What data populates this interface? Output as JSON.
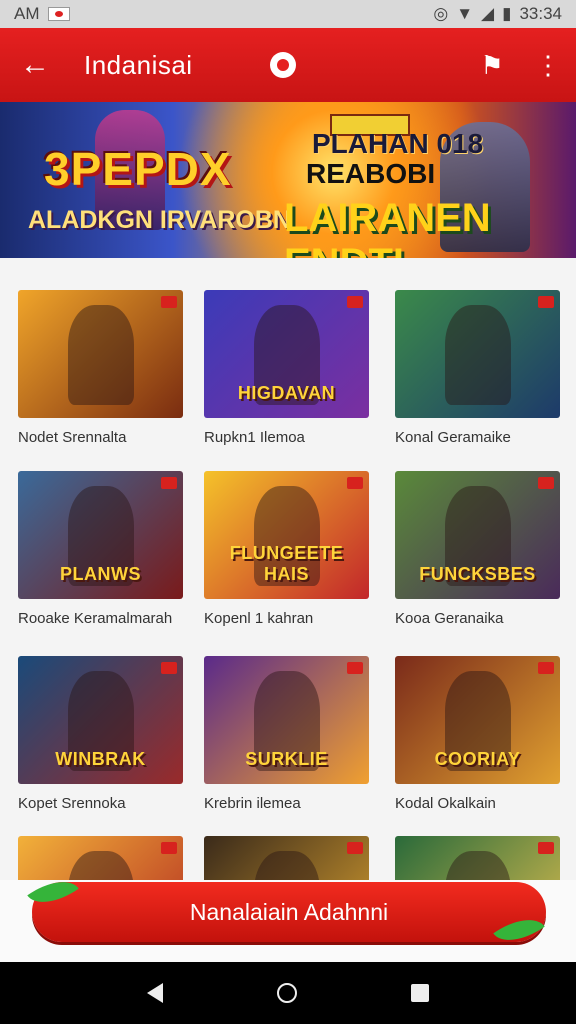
{
  "status_bar": {
    "left_text": "AM",
    "time": "33:34"
  },
  "app_bar": {
    "title": "Indanisai"
  },
  "icons": {
    "back": "arrow-left-icon",
    "chat": "chat-flag-icon",
    "more": "more-vertical-icon"
  },
  "banner": {
    "headline": "3PEPDX",
    "subtitle": "ALADKGN IRVAROBN",
    "tag_line_1": "PLAHAN 018",
    "tag_line_2": "REABOBI",
    "main_line": "LAIRANEN ENDTI"
  },
  "games": [
    {
      "title": "Nodet Srennalta",
      "caption": "",
      "colors": [
        "#f0a52a",
        "#7a2c10"
      ]
    },
    {
      "title": "Rupkn1 Ilemoa",
      "caption": "HIGDAVAN",
      "colors": [
        "#3b3bb8",
        "#7b2fa0"
      ]
    },
    {
      "title": "Konal Geramaike",
      "caption": "",
      "colors": [
        "#3b8a4a",
        "#1d3a6a"
      ]
    },
    {
      "title": "Rooake Keramalmarah",
      "caption": "PLANWS",
      "colors": [
        "#3a6a9a",
        "#7a1a1a"
      ]
    },
    {
      "title": "Kopenl 1 kahran",
      "caption": "FLUNGEETE HAIS",
      "colors": [
        "#f5c22a",
        "#c2262a"
      ]
    },
    {
      "title": "Kooa Geranaika",
      "caption": "FUNCKSBES",
      "colors": [
        "#5a8a3a",
        "#4a2a5a"
      ]
    },
    {
      "title": "Kopet Srennoka",
      "caption": "WINBRAK",
      "colors": [
        "#1a4a7a",
        "#9a2a2a"
      ]
    },
    {
      "title": "Krebrin ilemea",
      "caption": "SURKLIE",
      "colors": [
        "#5a2a8a",
        "#f0a030"
      ]
    },
    {
      "title": "Kodal Okalkain",
      "caption": "COORIAY",
      "colors": [
        "#7a2a1a",
        "#e0a030"
      ]
    },
    {
      "title": "",
      "caption": "",
      "colors": [
        "#f2b13a",
        "#b22a20"
      ]
    },
    {
      "title": "",
      "caption": "",
      "colors": [
        "#3a2a1a",
        "#d8a030"
      ]
    },
    {
      "title": "",
      "caption": "",
      "colors": [
        "#2a6a3a",
        "#e0c050"
      ]
    }
  ],
  "action": {
    "label": "Nanalaiain Adahnni"
  },
  "nav": {
    "back": "nav-back-icon",
    "home": "nav-home-icon",
    "recent": "nav-recent-icon"
  }
}
